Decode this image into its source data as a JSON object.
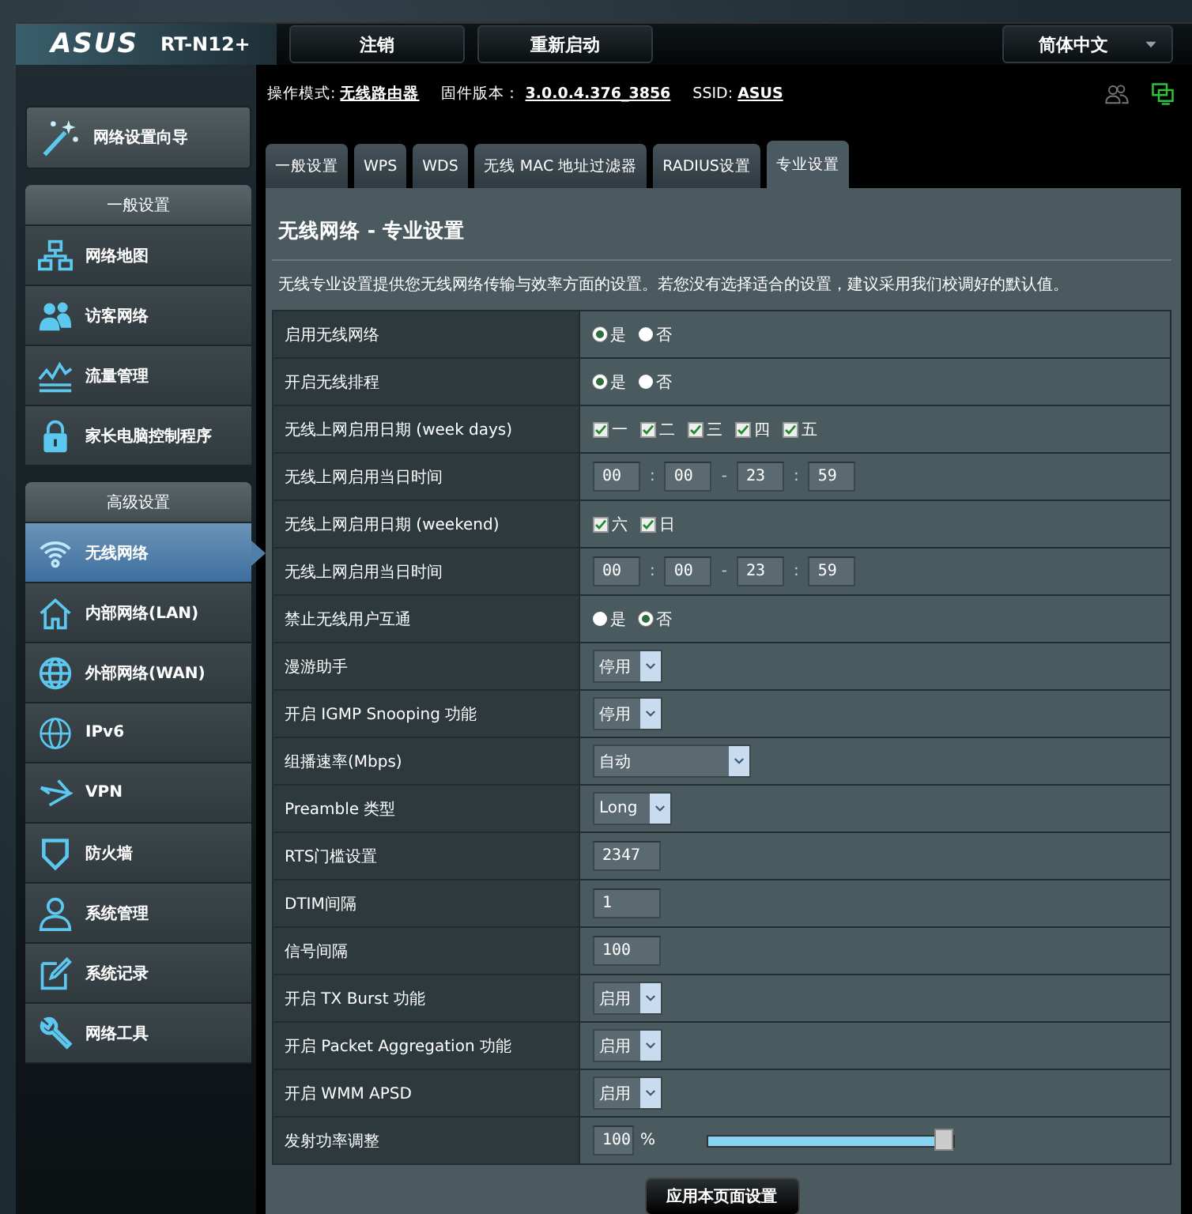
{
  "header": {
    "logo": "ASUS",
    "model": "RT-N12+",
    "buttons": [
      "注销",
      "重新启动"
    ],
    "language": "简体中文"
  },
  "info": [
    {
      "label": "操作模式:",
      "value": "无线路由器"
    },
    {
      "label": "固件版本：",
      "value": "3.0.0.4.376_3856"
    },
    {
      "label": "SSID:",
      "value": "ASUS"
    }
  ],
  "wizard": "网络设置向导",
  "sidebar": [
    {
      "title": "一般设置",
      "items": [
        {
          "label": "网络地图",
          "selected": false
        },
        {
          "label": "访客网络",
          "selected": false
        },
        {
          "label": "流量管理",
          "selected": false
        },
        {
          "label": "家长电脑控制程序",
          "selected": false
        }
      ]
    },
    {
      "title": "高级设置",
      "items": [
        {
          "label": "无线网络",
          "selected": true
        },
        {
          "label": "内部网络(LAN)",
          "selected": false
        },
        {
          "label": "外部网络(WAN)",
          "selected": false
        },
        {
          "label": "IPv6",
          "selected": false
        },
        {
          "label": "VPN",
          "selected": false
        },
        {
          "label": "防火墙",
          "selected": false
        },
        {
          "label": "系统管理",
          "selected": false
        },
        {
          "label": "系统记录",
          "selected": false
        },
        {
          "label": "网络工具",
          "selected": false
        }
      ]
    }
  ],
  "tabs": [
    {
      "label": "一般设置",
      "selected": false
    },
    {
      "label": "WPS",
      "selected": false
    },
    {
      "label": "WDS",
      "selected": false
    },
    {
      "label": "无线 MAC 地址过滤器",
      "selected": false
    },
    {
      "label": "RADIUS设置",
      "selected": false
    },
    {
      "label": "专业设置",
      "selected": true
    }
  ],
  "panel": {
    "title": "无线网络 - 专业设置",
    "description": "无线专业设置提供您无线网络传输与效率方面的设置。若您没有选择适合的设置，建议采用我们校调好的默认值。",
    "rows": [
      {
        "label": "启用无线网络",
        "kind": "radio",
        "options": [
          {
            "label": "是",
            "selected": true
          },
          {
            "label": "否",
            "selected": false
          }
        ]
      },
      {
        "label": "开启无线排程",
        "kind": "radio",
        "options": [
          {
            "label": "是",
            "selected": true
          },
          {
            "label": "否",
            "selected": false
          }
        ]
      },
      {
        "label": "无线上网启用日期 (week days)",
        "kind": "checkbox",
        "options": [
          {
            "label": "一",
            "checked": true
          },
          {
            "label": "二",
            "checked": true
          },
          {
            "label": "三",
            "checked": true
          },
          {
            "label": "四",
            "checked": true
          },
          {
            "label": "五",
            "checked": true
          }
        ]
      },
      {
        "label": "无线上网启用当日时间",
        "kind": "time",
        "values": [
          "00",
          "00",
          "23",
          "59"
        ],
        "separators": [
          ":",
          "-",
          ":"
        ]
      },
      {
        "label": "无线上网启用日期 (weekend)",
        "kind": "checkbox",
        "options": [
          {
            "label": "六",
            "checked": true
          },
          {
            "label": "日",
            "checked": true
          }
        ]
      },
      {
        "label": "无线上网启用当日时间",
        "kind": "time",
        "values": [
          "00",
          "00",
          "23",
          "59"
        ],
        "separators": [
          ":",
          "-",
          ":"
        ]
      },
      {
        "label": "禁止无线用户互通",
        "kind": "radio",
        "options": [
          {
            "label": "是",
            "selected": false
          },
          {
            "label": "否",
            "selected": true
          }
        ]
      },
      {
        "label": "漫游助手",
        "kind": "select",
        "value": "停用"
      },
      {
        "label": "开启 IGMP Snooping 功能",
        "kind": "select",
        "value": "停用"
      },
      {
        "label": "组播速率(Mbps)",
        "kind": "select",
        "value": "自动",
        "wide": true
      },
      {
        "label": "Preamble 类型",
        "kind": "select",
        "value": "Long"
      },
      {
        "label": "RTS门槛设置",
        "kind": "text",
        "value": "2347"
      },
      {
        "label": "DTIM间隔",
        "kind": "text",
        "value": "1"
      },
      {
        "label": "信号间隔",
        "kind": "text",
        "value": "100"
      },
      {
        "label": "开启 TX Burst 功能",
        "kind": "select",
        "value": "启用"
      },
      {
        "label": "开启 Packet Aggregation 功能",
        "kind": "select",
        "value": "启用"
      },
      {
        "label": "开启 WMM APSD",
        "kind": "select",
        "value": "启用"
      },
      {
        "label": "发射功率调整",
        "kind": "slider",
        "value": "100",
        "unit": "%",
        "level": 1
      }
    ],
    "apply": "应用本页面设置"
  }
}
